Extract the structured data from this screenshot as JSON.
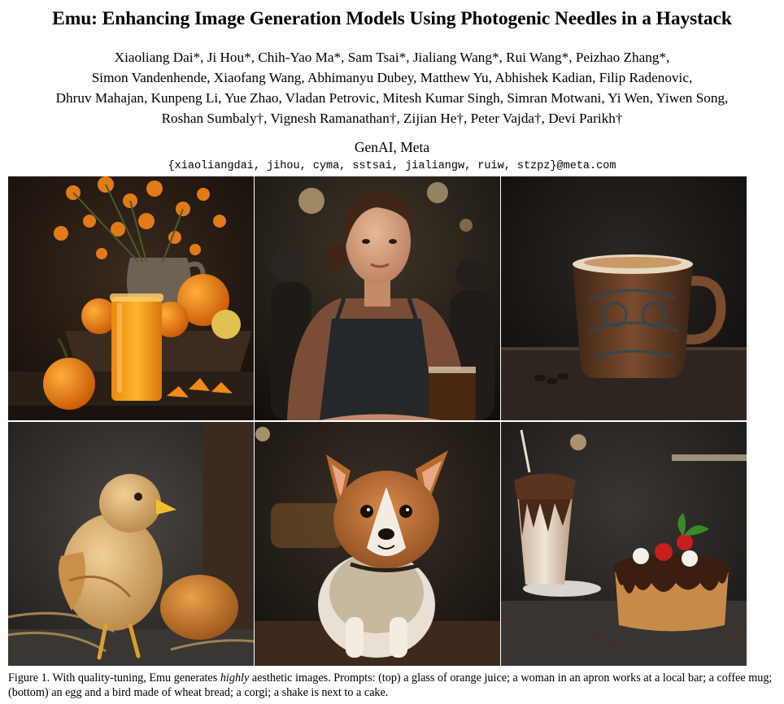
{
  "paper": {
    "title": "Emu: Enhancing Image Generation Models Using Photogenic Needles in a Haystack",
    "author_lines": [
      "Xiaoliang Dai*, Ji Hou*, Chih-Yao Ma*, Sam Tsai*, Jialiang Wang*, Rui Wang*, Peizhao Zhang*,",
      "Simon Vandenhende, Xiaofang Wang, Abhimanyu Dubey, Matthew Yu, Abhishek Kadian, Filip Radenovic,",
      "Dhruv Mahajan, Kunpeng Li, Yue Zhao, Vladan Petrovic, Mitesh Kumar Singh, Simran Motwani, Yi Wen, Yiwen Song,",
      "Roshan Sumbaly†, Vignesh Ramanathan†, Zijian He†, Peter Vajda†, Devi Parikh†"
    ],
    "affiliation": "GenAI, Meta",
    "emails": "{xiaoliangdai, jihou, cyma, sstsai, jialiangw, ruiw, stzpz}@meta.com"
  },
  "figure": {
    "images": [
      {
        "icon": "orange-juice-image"
      },
      {
        "icon": "barista-woman-image"
      },
      {
        "icon": "coffee-mug-image"
      },
      {
        "icon": "bread-bird-image"
      },
      {
        "icon": "corgi-image"
      },
      {
        "icon": "shake-cake-image"
      }
    ],
    "caption_prefix": "Figure 1. With quality-tuning, Emu generates ",
    "caption_emph": "highly",
    "caption_suffix": " aesthetic images. Prompts: (top) a glass of orange juice; a woman in an apron works at a local bar; a coffee mug; (bottom) an egg and a bird made of wheat bread; a corgi; a shake is next to a cake."
  }
}
